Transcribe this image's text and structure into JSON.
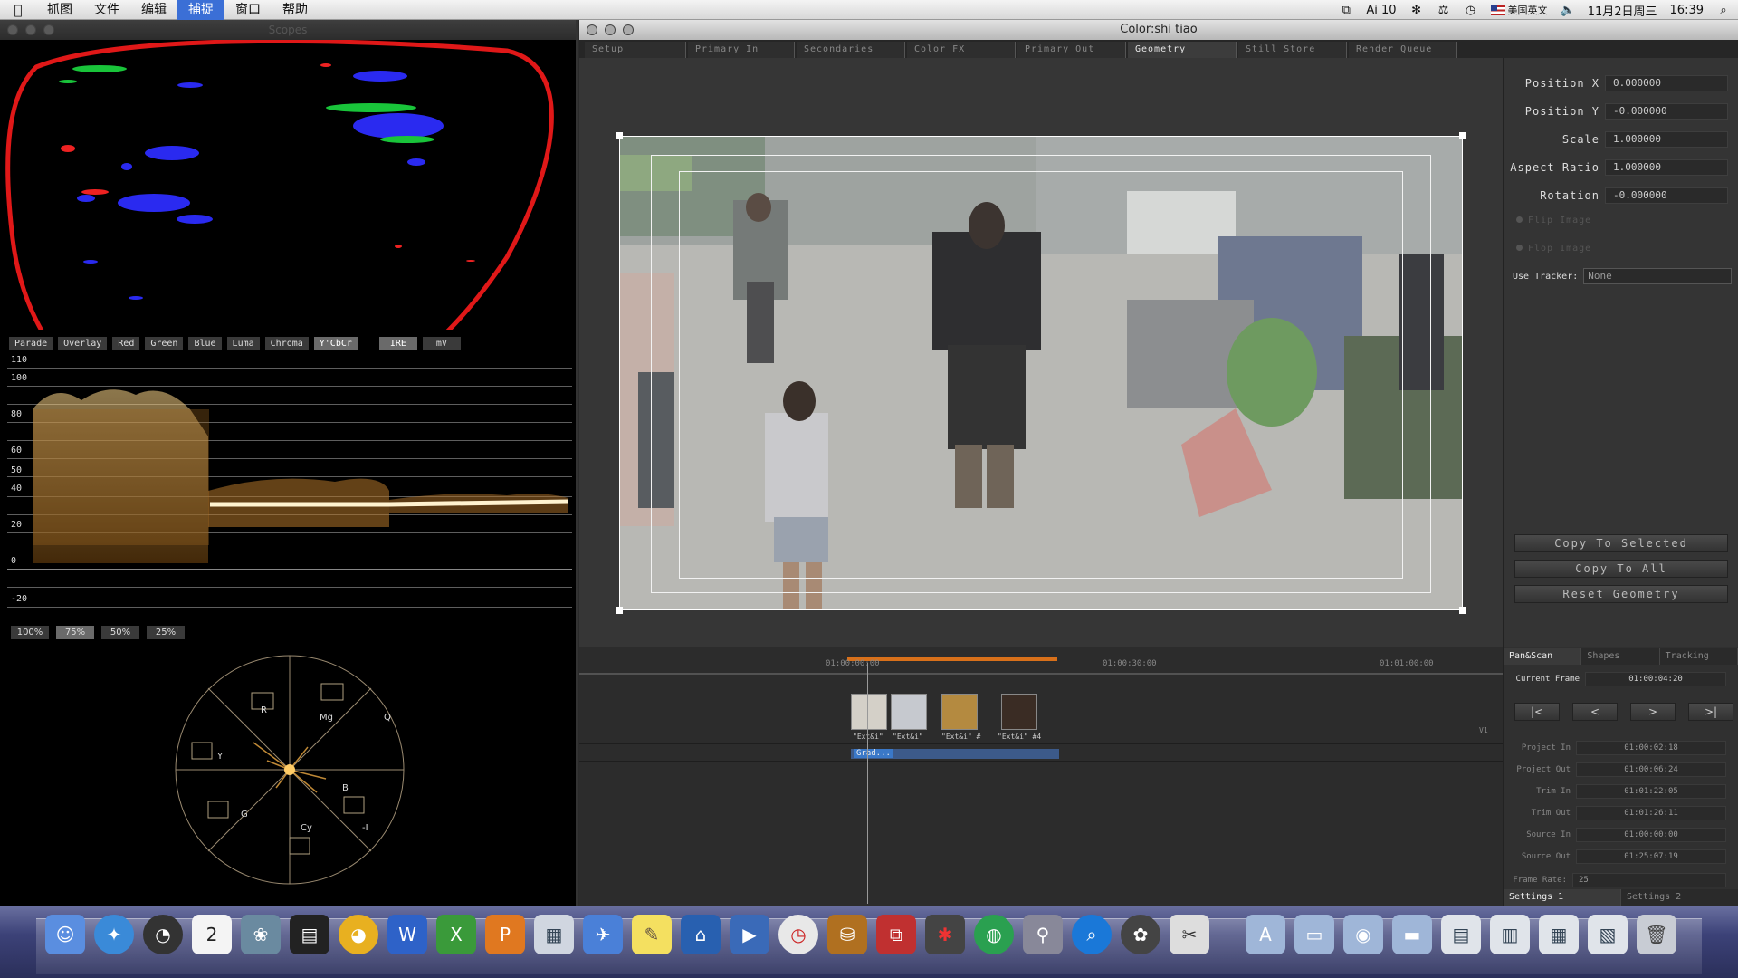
{
  "menubar": {
    "items": [
      "抓图",
      "文件",
      "编辑",
      "捕捉",
      "窗口",
      "帮助"
    ],
    "active_index": 3,
    "status": {
      "sync_count": "10",
      "input_source": "美国英文",
      "date": "11月2日周三",
      "time": "16:39"
    }
  },
  "scopes_window": {
    "title": "Scopes",
    "scope_buttons": [
      "Parade",
      "Overlay",
      "Red",
      "Green",
      "Blue",
      "Luma",
      "Chroma",
      "Y'CbCr"
    ],
    "scope_selected": "Y'CbCr",
    "unit_buttons": [
      "IRE",
      "mV"
    ],
    "unit_selected": "IRE",
    "waveform_scale": [
      "110",
      "100",
      "80",
      "60",
      "50",
      "40",
      "20",
      "0",
      "-20"
    ],
    "zoom_buttons": [
      "100%",
      "75%",
      "50%",
      "25%"
    ],
    "zoom_selected": "75%",
    "vectorscope_targets": [
      "R",
      "Mg",
      "Q",
      "Yl",
      "B",
      "G",
      "Cy",
      "-I"
    ]
  },
  "color_window": {
    "title": "Color:shi tiao",
    "tabs": [
      "Setup",
      "Primary In",
      "Secondaries",
      "Color FX",
      "Primary Out",
      "Geometry",
      "Still Store",
      "Render Queue"
    ],
    "tab_selected": "Geometry",
    "geometry": {
      "params": [
        {
          "label": "Position X",
          "value": "0.000000"
        },
        {
          "label": "Position Y",
          "value": "-0.000000"
        },
        {
          "label": "Scale",
          "value": "1.000000"
        },
        {
          "label": "Aspect Ratio",
          "value": "1.000000"
        },
        {
          "label": "Rotation",
          "value": "-0.000000"
        }
      ],
      "flip_labels": [
        "Flip Image",
        "Flop Image"
      ],
      "tracker_label": "Use Tracker:",
      "tracker_value": "None",
      "buttons": [
        "Copy To Selected",
        "Copy To All",
        "Reset Geometry"
      ]
    },
    "timeline": {
      "timecodes": [
        "01:00:00:00",
        "01:00:30:00",
        "01:01:00:00"
      ],
      "clip_labels": [
        "\"Ext&i\"",
        "\"Ext&i\"",
        "\"Ext&i\" #",
        "\"Ext&i\" #4"
      ],
      "track_label": "V1",
      "grade_label": "Grad..."
    },
    "lower_panel": {
      "subtabs": [
        "Pan&Scan",
        "Shapes",
        "Tracking"
      ],
      "subtab_selected": "Pan&Scan",
      "current_frame_label": "Current Frame",
      "current_frame": "01:00:04:20",
      "nav_buttons": [
        "|<",
        "<",
        ">",
        ">|"
      ],
      "info": [
        {
          "label": "Project In",
          "value": "01:00:02:18"
        },
        {
          "label": "Project Out",
          "value": "01:00:06:24"
        },
        {
          "label": "Trim In",
          "value": "01:01:22:05"
        },
        {
          "label": "Trim Out",
          "value": "01:01:26:11"
        },
        {
          "label": "Source In",
          "value": "01:00:00:00"
        },
        {
          "label": "Source Out",
          "value": "01:25:07:19"
        }
      ],
      "frame_rate_label": "Frame Rate:",
      "frame_rate": "25",
      "settings_tabs": [
        "Settings 1",
        "Settings 2"
      ]
    }
  },
  "dock": {
    "icons": [
      "finder-icon",
      "safari-icon",
      "dashboard-icon",
      "calendar-icon",
      "iphoto-icon",
      "clapper-icon",
      "qq-icon",
      "word-icon",
      "excel-icon",
      "powerpoint-icon",
      "preview-icon",
      "mail-icon",
      "stickies-icon",
      "home-icon",
      "quicktime-icon",
      "clock-icon",
      "bucket-icon",
      "parallels-icon",
      "spider-icon",
      "globe-icon",
      "satellite-icon",
      "search-icon",
      "color-icon",
      "scissors-icon",
      "folder-app-icon",
      "folder-doc-icon",
      "folder-dl-icon",
      "folder-icon",
      "window-1-icon",
      "window-2-icon",
      "window-3-icon",
      "window-4-icon",
      "trash-icon"
    ],
    "calendar_day": "2"
  }
}
